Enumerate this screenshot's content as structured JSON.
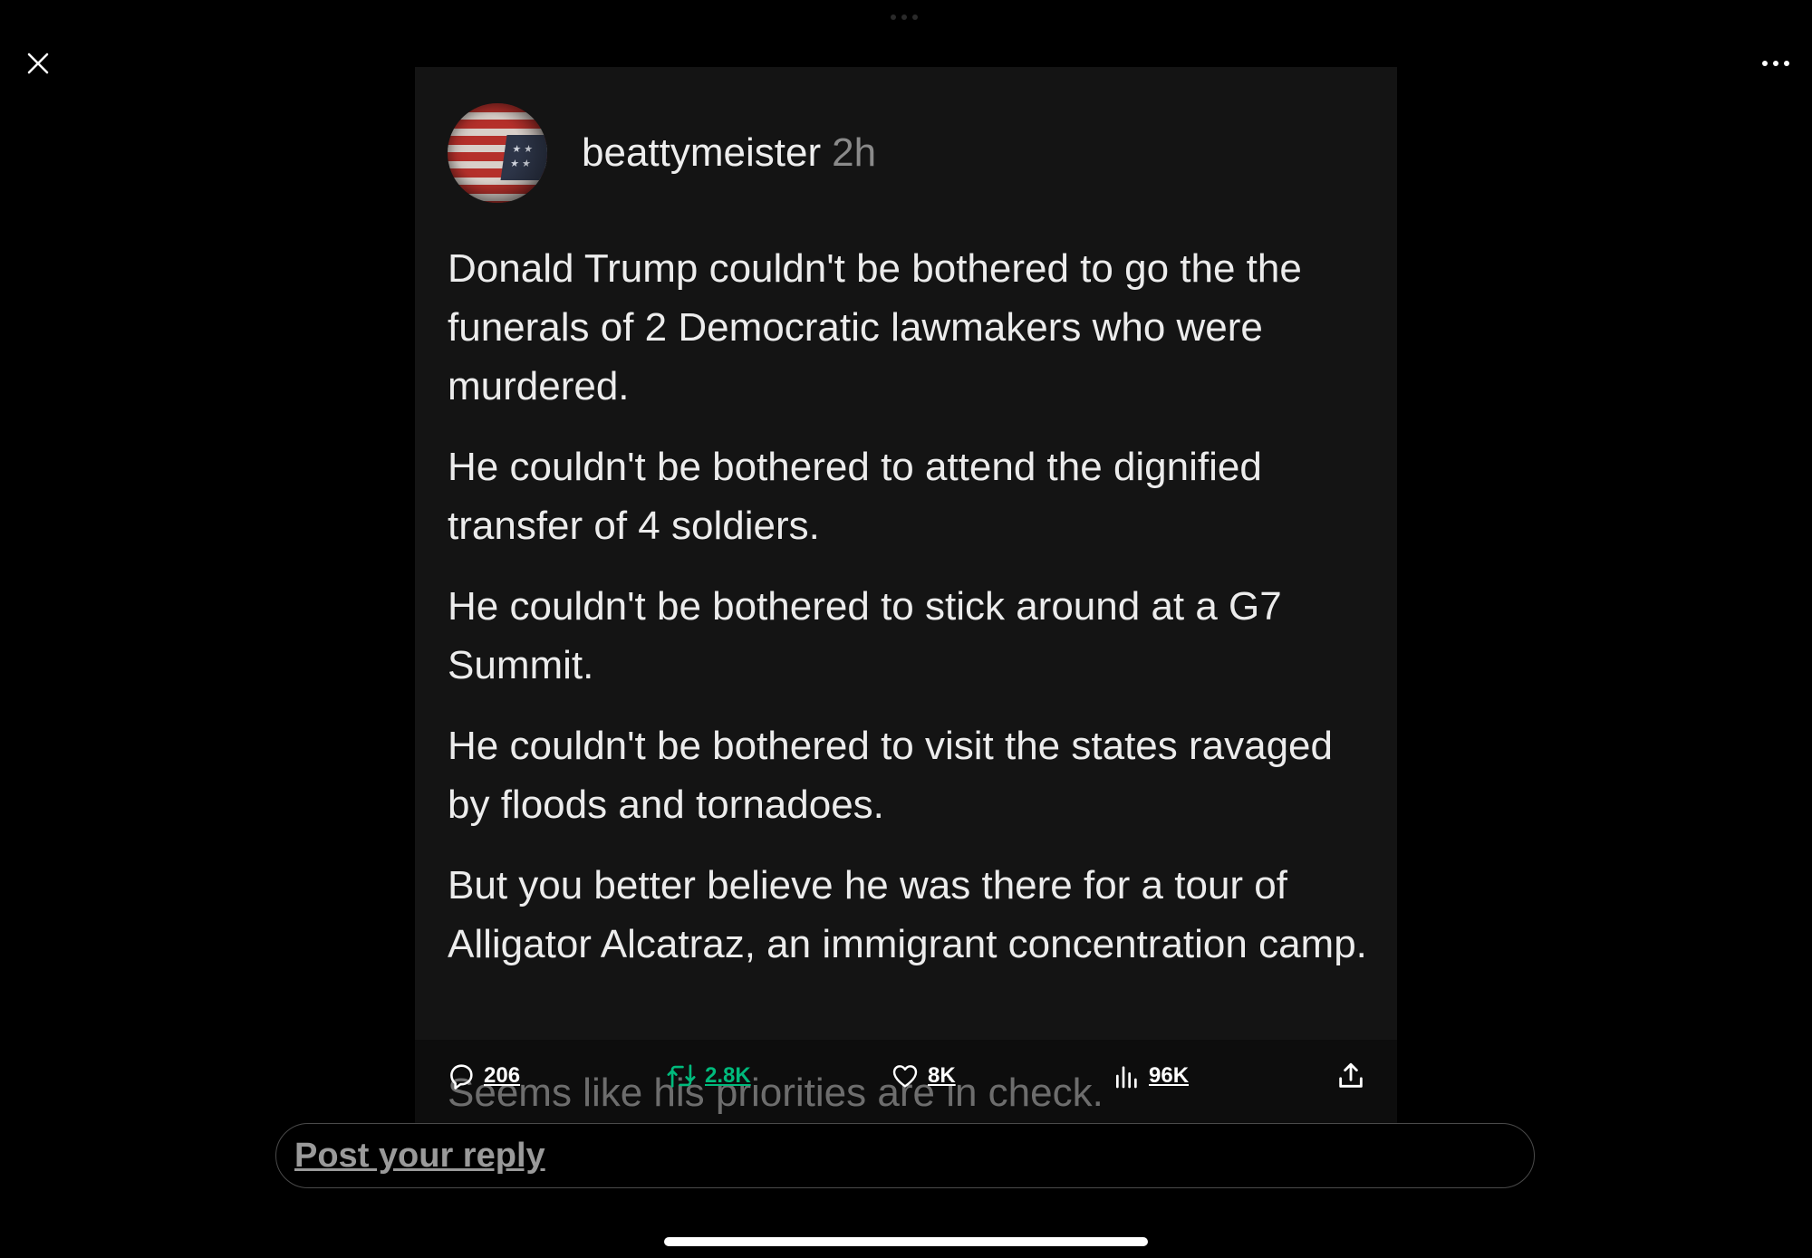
{
  "toolbar": {
    "close_icon": "close-icon",
    "more_icon": "more-horizontal-icon"
  },
  "post": {
    "username": "beattymeister",
    "timestamp": "2h",
    "paragraphs": [
      "Donald Trump couldn't be bothered to go the the funerals of 2 Democratic lawmakers who were murdered.",
      "He couldn't be bothered to attend the dignified transfer of 4 soldiers.",
      "He couldn't be bothered to stick around at a G7 Summit.",
      "He couldn't be bothered to visit the states ravaged by floods and tornadoes.",
      "But you better believe he was there for a tour of Alligator Alcatraz, an immigrant concentration camp."
    ],
    "partial_line": "Seems like his priorities are in check."
  },
  "actions": {
    "replies": "206",
    "reposts": "2.8K",
    "likes": "8K",
    "views": "96K"
  },
  "reply_box": {
    "placeholder": "Post your reply"
  },
  "colors": {
    "background": "#000000",
    "media_background": "#141414",
    "repost_active": "#00ba7c",
    "text": "#ffffff"
  }
}
